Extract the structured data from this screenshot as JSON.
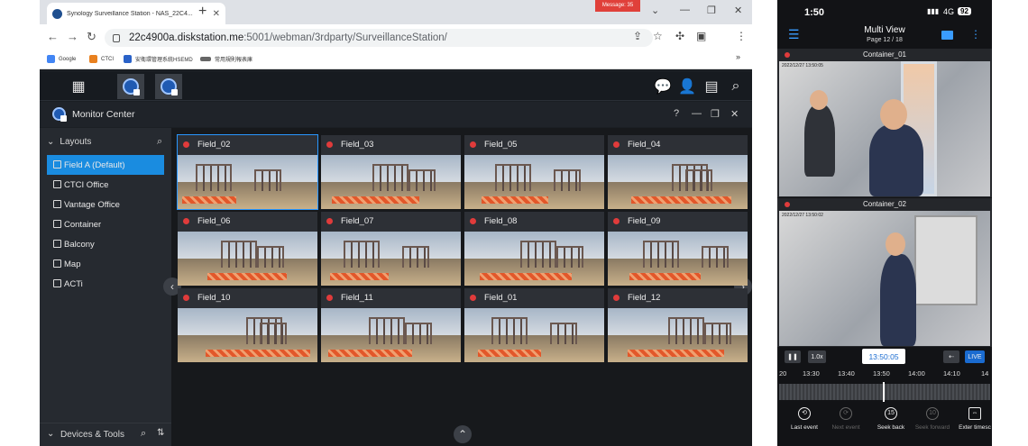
{
  "browser": {
    "tab_title": "Synology Surveillance Station - NAS_22C4...",
    "notification": "Message: 35",
    "url_host": "22c4900a.diskstation.me",
    "url_path": ":5001/webman/3rdparty/SurveillanceStation/",
    "bookmarks": [
      "Google",
      "CTCI",
      "安衛環管理系統HSEMD",
      "常用規則報表庫"
    ]
  },
  "app": {
    "title": "Monitor Center",
    "layouts_label": "Layouts",
    "layouts": [
      {
        "label": "Field A (Default)",
        "selected": true
      },
      {
        "label": "CTCI Office",
        "selected": false
      },
      {
        "label": "Vantage Office",
        "selected": false
      },
      {
        "label": "Container",
        "selected": false
      },
      {
        "label": "Balcony",
        "selected": false
      },
      {
        "label": "Map",
        "selected": false
      },
      {
        "label": "ACTi",
        "selected": false
      }
    ],
    "devices_label": "Devices & Tools",
    "cameras": [
      "Field_02",
      "Field_03",
      "Field_05",
      "Field_04",
      "Field_06",
      "Field_07",
      "Field_08",
      "Field_09",
      "Field_10",
      "Field_11",
      "Field_01",
      "Field_12"
    ],
    "accent": "#1a8ce0"
  },
  "phone": {
    "time": "1:50",
    "network": "4G",
    "battery": "92",
    "title": "Multi View",
    "page": "Page 12 / 18",
    "feeds": [
      {
        "name": "Container_01",
        "stamp": "2022/12/27 13:50:05"
      },
      {
        "name": "Container_02",
        "stamp": "2022/12/27 13:50:02"
      }
    ],
    "speed": "1.0x",
    "current_time": "13:50:05",
    "live": "LIVE",
    "ticks": [
      "20",
      "13:30",
      "13:40",
      "13:50",
      "14:00",
      "14:10",
      "14"
    ],
    "buttons": [
      "Last event",
      "Next event",
      "Seek back",
      "Seek forward",
      "Exter timesc"
    ]
  }
}
